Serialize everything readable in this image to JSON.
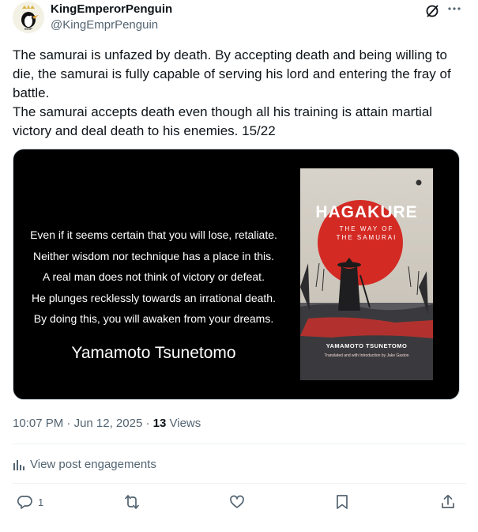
{
  "author": {
    "display_name": "KingEmperorPenguin",
    "handle": "@KingEmprPenguin",
    "avatar_text": "EMP"
  },
  "tweet": {
    "paragraphs": [
      "The samurai is unfazed by death. By accepting death and being willing to die, the samurai is fully capable of serving his lord and entering the fray of battle.",
      "The samurai accepts death even though all his training is attain martial victory and deal death to his enemies. 15/22"
    ]
  },
  "image": {
    "quote_lines": [
      "Even if it seems certain that you will lose, retaliate.",
      "Neither wisdom nor technique has a place in this.",
      "A real man does not think of victory or defeat.",
      "He plunges recklessly towards an irrational death.",
      "By doing this, you will awaken from your dreams."
    ],
    "quote_author": "Yamamoto Tsunetomo",
    "book_title": "HAGAKURE",
    "book_subtitle_1": "THE WAY OF",
    "book_subtitle_2": "THE SAMURAI",
    "book_author": "YAMAMOTO TSUNETOMO",
    "book_translator": "Translated and with Introduction by Jake Gaston"
  },
  "meta": {
    "time": "10:07 PM",
    "separator": "·",
    "date": "Jun 12, 2025",
    "views_count": "13",
    "views_label": "Views"
  },
  "engagements_label": "View post engagements",
  "actions": {
    "reply_count": "1"
  },
  "colors": {
    "text": "#0f1419",
    "secondary": "#536471",
    "divider": "#eff3f4",
    "book_red": "#d42a24"
  },
  "icons": [
    "grok-icon",
    "more-icon",
    "analytics-icon",
    "reply-icon",
    "retweet-icon",
    "like-icon",
    "bookmark-icon",
    "share-icon"
  ]
}
